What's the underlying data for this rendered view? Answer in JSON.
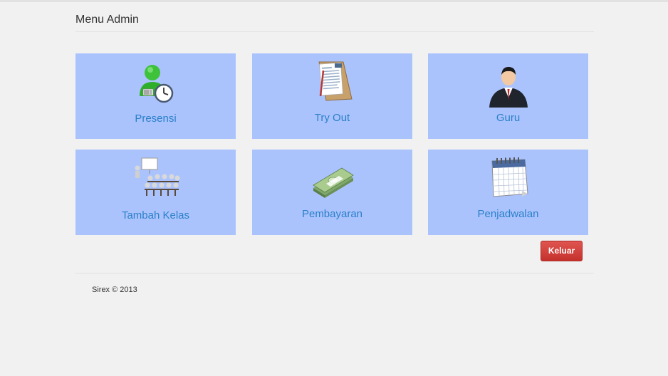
{
  "header": {
    "title": "Menu Admin"
  },
  "menu": {
    "tiles": [
      {
        "label": "Presensi",
        "icon": "user-clock-icon"
      },
      {
        "label": "Try Out",
        "icon": "clipboard-icon"
      },
      {
        "label": "Guru",
        "icon": "teacher-icon"
      },
      {
        "label": "Tambah Kelas",
        "icon": "classroom-icon"
      },
      {
        "label": "Pembayaran",
        "icon": "money-icon"
      },
      {
        "label": "Penjadwalan",
        "icon": "calendar-icon"
      }
    ]
  },
  "actions": {
    "logout_label": "Keluar"
  },
  "footer": {
    "text": "Sirex © 2013"
  },
  "colors": {
    "tile": "#abc3fd",
    "tile_text": "#2a7fc9",
    "logout": "#d9534f"
  }
}
